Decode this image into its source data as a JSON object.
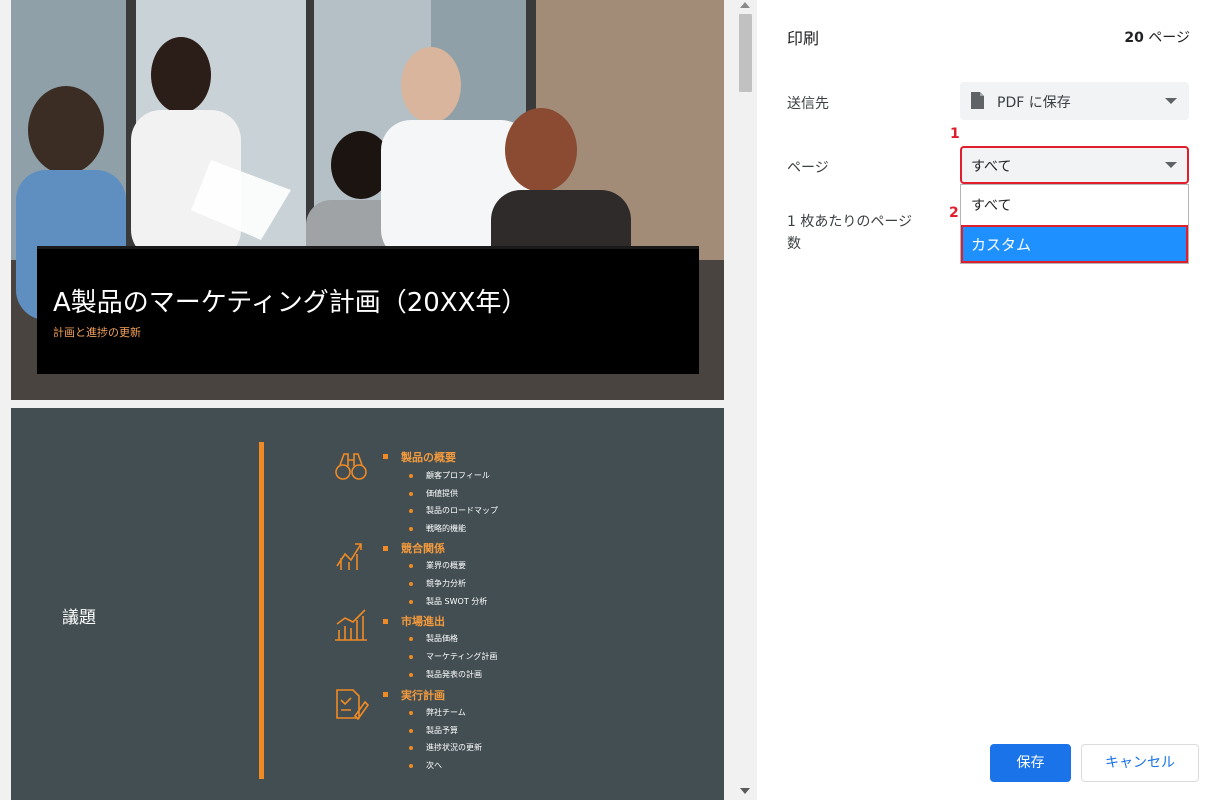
{
  "preview": {
    "slide1": {
      "title": "A製品のマーケティング計画（20XX年）",
      "subtitle": "計画と進捗の更新"
    },
    "slide2": {
      "label": "議題",
      "sections": [
        {
          "icon": "binoculars-icon",
          "heading": "製品の概要",
          "items": [
            "顧客プロフィール",
            "価値提供",
            "製品のロードマップ",
            "戦略的機能"
          ]
        },
        {
          "icon": "growth-arrows-icon",
          "heading": "競合関係",
          "items": [
            "業界の概要",
            "競争力分析",
            "製品 SWOT 分析"
          ]
        },
        {
          "icon": "bar-chart-icon",
          "heading": "市場進出",
          "items": [
            "製品価格",
            "マーケティング計画",
            "製品発表の計画"
          ]
        },
        {
          "icon": "document-pen-icon",
          "heading": "実行計画",
          "items": [
            "弊社チーム",
            "製品予算",
            "進捗状況の更新",
            "次へ"
          ]
        }
      ]
    }
  },
  "panel": {
    "title": "印刷",
    "page_count_number": "20",
    "page_count_unit": " ページ",
    "destination_label": "送信先",
    "destination_value": "PDF に保存",
    "pages_label": "ページ",
    "pages_value": "すべて",
    "pages_per_sheet_label_line1": "1 枚あたりのページ",
    "pages_per_sheet_label_line2": "数",
    "dropdown_options": [
      "すべて",
      "カスタム"
    ],
    "callouts": [
      "1",
      "2"
    ],
    "save_label": "保存",
    "cancel_label": "キャンセル"
  },
  "colors": {
    "accent_blue": "#1a73e8",
    "highlight_red": "#e01e2d",
    "slide_orange": "#f08a24",
    "selected_option": "#1e90ff"
  }
}
